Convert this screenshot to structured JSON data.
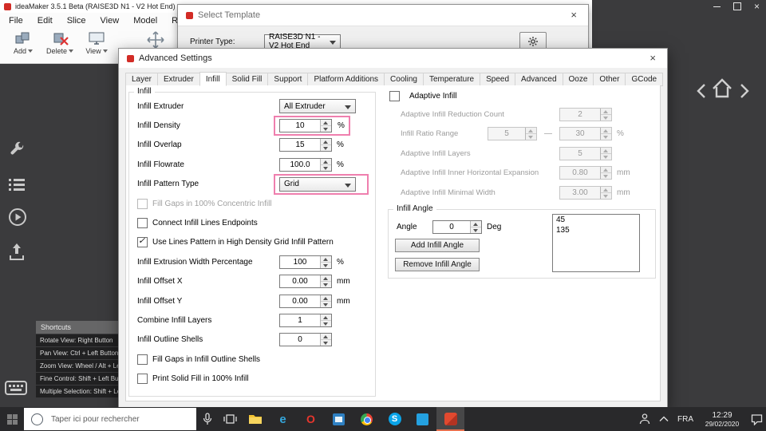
{
  "colors": {
    "highlight": "#ef7fae",
    "brand_red": "#d22c26",
    "viewport": "#3b3b3d",
    "taskbar": "#29292b"
  },
  "icons": {
    "close": "×",
    "check": "✓",
    "dash": "—"
  },
  "app": {
    "title": "ideaMaker 3.5.1 Beta (RAISE3D N1 - V2 Hot End) -",
    "menu": [
      "File",
      "Edit",
      "Slice",
      "View",
      "Model",
      "Repair"
    ],
    "toolbar": {
      "add": "Add",
      "delete": "Delete",
      "view": "View"
    }
  },
  "select_template": {
    "title": "Select Template",
    "printer_type_label": "Printer Type:",
    "printer_type_value": "RAISE3D N1 - V2 Hot End"
  },
  "advanced": {
    "title": "Advanced Settings",
    "tabs": [
      "Layer",
      "Extruder",
      "Infill",
      "Solid Fill",
      "Support",
      "Platform Additions",
      "Cooling",
      "Temperature",
      "Speed",
      "Advanced",
      "Ooze",
      "Other",
      "GCode"
    ],
    "active_tab": "Infill",
    "infill": {
      "group_title": "Infill",
      "extruder_label": "Infill Extruder",
      "extruder_value": "All Extruder",
      "density_label": "Infill Density",
      "density_value": "10",
      "density_unit": "%",
      "overlap_label": "Infill Overlap",
      "overlap_value": "15",
      "overlap_unit": "%",
      "flowrate_label": "Infill Flowrate",
      "flowrate_value": "100.0",
      "flowrate_unit": "%",
      "pattern_label": "Infill Pattern Type",
      "pattern_value": "Grid",
      "cb_concentric": "Fill Gaps in 100% Concentric Infill",
      "cb_connect": "Connect Infill Lines Endpoints",
      "cb_lines": "Use Lines Pattern in High Density Grid Infill Pattern",
      "width_label": "Infill Extrusion Width Percentage",
      "width_value": "100",
      "width_unit": "%",
      "offsetx_label": "Infill Offset X",
      "offsetx_value": "0.00",
      "offsetx_unit": "mm",
      "offsety_label": "Infill Offset Y",
      "offsety_value": "0.00",
      "offsety_unit": "mm",
      "combine_label": "Combine Infill Layers",
      "combine_value": "1",
      "shells_label": "Infill Outline Shells",
      "shells_value": "0",
      "cb_gaps": "Fill Gaps in Infill Outline Shells",
      "cb_solid": "Print Solid Fill in 100% Infill"
    },
    "adaptive": {
      "cb_label": "Adaptive Infill",
      "reduction_label": "Adaptive Infill Reduction Count",
      "reduction_value": "2",
      "ratio_label": "Infill Ratio Range",
      "ratio_low": "5",
      "ratio_high": "30",
      "ratio_unit": "%",
      "layers_label": "Adaptive Infill Layers",
      "layers_value": "5",
      "expansion_label": "Adaptive Infill Inner Horizontal Expansion",
      "expansion_value": "0.80",
      "expansion_unit": "mm",
      "minwidth_label": "Adaptive Infill Minimal Width",
      "minwidth_value": "3.00",
      "minwidth_unit": "mm"
    },
    "angle": {
      "group_title": "Infill Angle",
      "label": "Angle",
      "value": "0",
      "unit": "Deg",
      "add_button": "Add Infill Angle",
      "remove_button": "Remove Infill Angle",
      "list": [
        "45",
        "135"
      ]
    }
  },
  "shortcuts": {
    "title": "Shortcuts",
    "items": [
      "Rotate View: Right Button",
      "Pan View: Ctrl + Left Button",
      "Zoom View: Wheel / Alt + Le...",
      "Fine Control: Shift + Left Bu...",
      "Multiple Selection: Shift + Le..."
    ]
  },
  "taskbar": {
    "search_placeholder": "Taper ici pour rechercher",
    "glyphs": {
      "edge": "e",
      "opera": "O",
      "skype": "S"
    },
    "language": "FRA",
    "time": "12:29",
    "date": "29/02/2020"
  }
}
